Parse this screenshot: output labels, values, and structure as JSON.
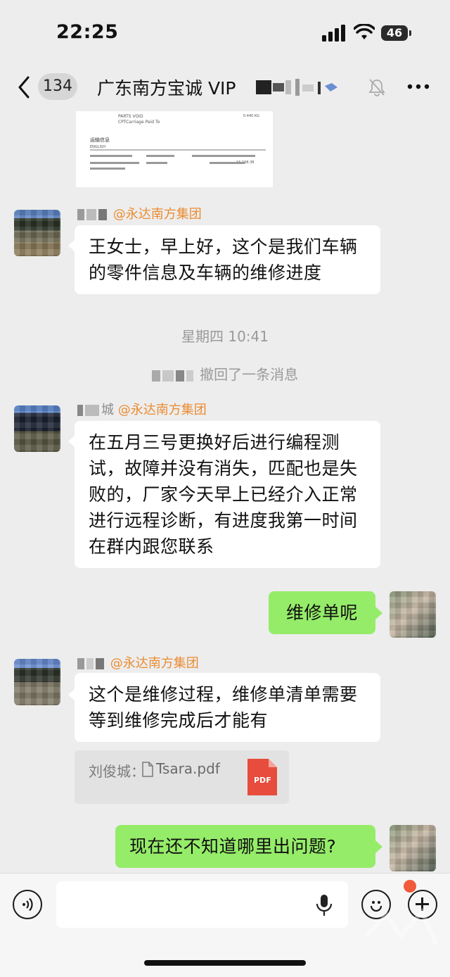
{
  "status_bar": {
    "time": "22:25",
    "battery": "46"
  },
  "nav": {
    "back_count": "134",
    "title": "广东南方宝诚 VIP"
  },
  "doc_preview": {
    "rows": [
      "PARTS VOID",
      "CPTCarriage Paid To",
      "运输信息",
      "ENGLISH",
      "0.440 KG",
      "16,198.38"
    ]
  },
  "messages": {
    "m1": {
      "mention": "@永达南方集团",
      "text": "王女士，早上好，这个是我们车辆的零件信息及车辆的维修进度"
    },
    "system_time": "星期四 10:41",
    "recall_text": "撤回了一条消息",
    "m2": {
      "sender_tail": "城",
      "mention": "@永达南方集团",
      "text": "在五月三号更换好后进行编程测试，故障并没有消失，匹配也是失败的，厂家今天早上已经介入正常进行远程诊断，有进度我第一时间在群内跟您联系"
    },
    "m3": {
      "text": "维修单呢"
    },
    "m4": {
      "mention": "@永达南方集团",
      "text": "这个是维修过程，维修单清单需要等到维修完成后才能有"
    },
    "file": {
      "prefix": "刘俊城：",
      "name": "Tsara.pdf",
      "badge": "PDF"
    },
    "m5": {
      "text": "现在还不知道哪里出问题?"
    }
  },
  "input": {
    "placeholder": ""
  },
  "colors": {
    "self_bubble": "#95ec69",
    "mention": "#ea8c32",
    "pdf": "#e74c3c"
  }
}
